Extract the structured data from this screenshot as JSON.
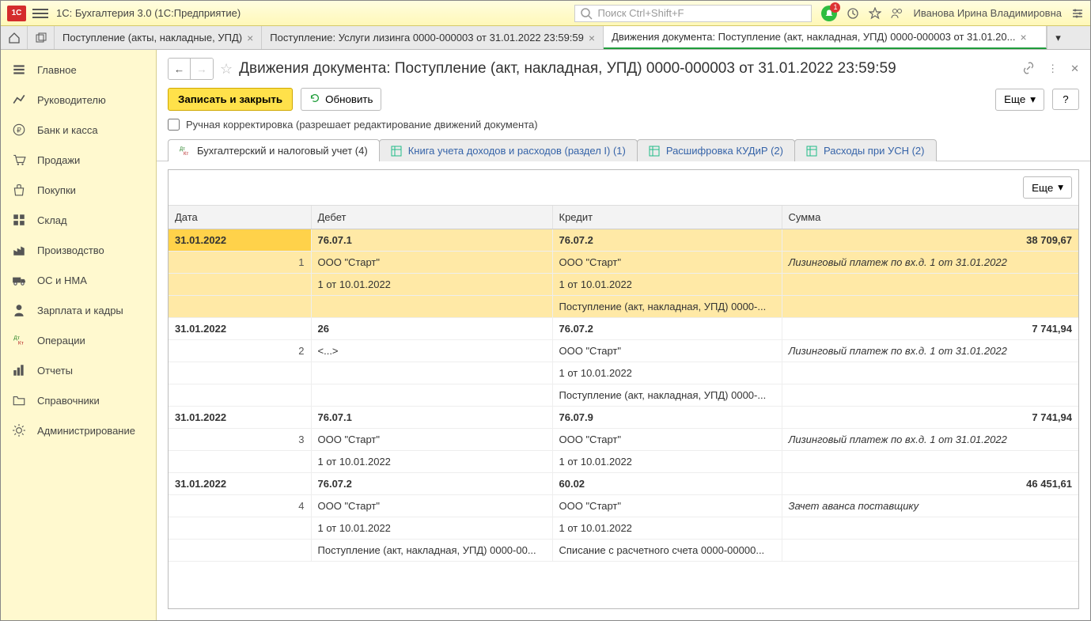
{
  "titlebar": {
    "app_title": "1С: Бухгалтерия 3.0  (1С:Предприятие)",
    "search_placeholder": "Поиск Ctrl+Shift+F",
    "bell_badge": "1",
    "user_name": "Иванова Ирина Владимировна"
  },
  "tabs": [
    {
      "label": "Поступление (акты, накладные, УПД)",
      "closable": true
    },
    {
      "label": "Поступление: Услуги лизинга 0000-000003 от 31.01.2022 23:59:59",
      "closable": true
    },
    {
      "label": "Движения документа: Поступление (акт, накладная, УПД) 0000-000003 от 31.01.20...",
      "closable": true,
      "active": true
    }
  ],
  "sidebar": [
    {
      "label": "Главное"
    },
    {
      "label": "Руководителю"
    },
    {
      "label": "Банк и касса"
    },
    {
      "label": "Продажи"
    },
    {
      "label": "Покупки"
    },
    {
      "label": "Склад"
    },
    {
      "label": "Производство"
    },
    {
      "label": "ОС и НМА"
    },
    {
      "label": "Зарплата и кадры"
    },
    {
      "label": "Операции"
    },
    {
      "label": "Отчеты"
    },
    {
      "label": "Справочники"
    },
    {
      "label": "Администрирование"
    }
  ],
  "page": {
    "title": "Движения документа: Поступление (акт, накладная, УПД) 0000-000003 от 31.01.2022 23:59:59",
    "btn_save": "Записать и закрыть",
    "btn_refresh": "Обновить",
    "btn_more": "Еще",
    "manual_label": "Ручная корректировка (разрешает редактирование движений документа)"
  },
  "subtabs": [
    {
      "label": "Бухгалтерский и налоговый учет (4)",
      "active": true
    },
    {
      "label": "Книга учета доходов и расходов (раздел I) (1)"
    },
    {
      "label": "Расшифровка КУДиР (2)"
    },
    {
      "label": "Расходы при УСН (2)"
    }
  ],
  "grid": {
    "more": "Еще",
    "headers": {
      "date": "Дата",
      "debit": "Дебет",
      "credit": "Кредит",
      "sum": "Сумма"
    },
    "rows": [
      {
        "selected": true,
        "date": "31.01.2022",
        "n": "1",
        "deb_acc": "76.07.1",
        "cred_acc": "76.07.2",
        "sum": "38 709,67",
        "deb1": "ООО \"Старт\"",
        "cred1": "ООО \"Старт\"",
        "note": "Лизинговый платеж по вх.д. 1 от 31.01.2022",
        "deb2": "1 от 10.01.2022",
        "cred2": "1 от 10.01.2022",
        "deb3": "",
        "cred3": "Поступление (акт, накладная, УПД) 0000-..."
      },
      {
        "date": "31.01.2022",
        "n": "2",
        "deb_acc": "26",
        "cred_acc": "76.07.2",
        "sum": "7 741,94",
        "deb1": "<...>",
        "cred1": "ООО \"Старт\"",
        "note": "Лизинговый платеж по вх.д. 1 от 31.01.2022",
        "deb2": "",
        "cred2": "1 от 10.01.2022",
        "deb3": "",
        "cred3": "Поступление (акт, накладная, УПД) 0000-..."
      },
      {
        "date": "31.01.2022",
        "n": "3",
        "deb_acc": "76.07.1",
        "cred_acc": "76.07.9",
        "sum": "7 741,94",
        "deb1": "ООО \"Старт\"",
        "cred1": "ООО \"Старт\"",
        "note": "Лизинговый платеж по вх.д. 1 от 31.01.2022",
        "deb2": "1 от 10.01.2022",
        "cred2": "1 от 10.01.2022",
        "deb3": "",
        "cred3": ""
      },
      {
        "date": "31.01.2022",
        "n": "4",
        "deb_acc": "76.07.2",
        "cred_acc": "60.02",
        "sum": "46 451,61",
        "deb1": "ООО \"Старт\"",
        "cred1": "ООО \"Старт\"",
        "note": "Зачет аванса поставщику",
        "deb2": "1 от 10.01.2022",
        "cred2": "1 от 10.01.2022",
        "deb3": "Поступление (акт, накладная, УПД) 0000-00...",
        "cred3": "Списание с расчетного счета 0000-00000..."
      }
    ]
  }
}
